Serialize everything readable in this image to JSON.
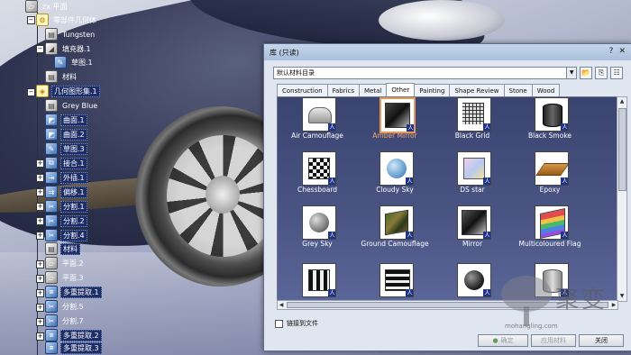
{
  "tree": {
    "items": [
      {
        "label": "zx 平面",
        "icon": "plane-icon"
      },
      {
        "label": "零部件几何体",
        "icon": "gear-icon"
      },
      {
        "label": "Tungsten",
        "icon": "material-icon"
      },
      {
        "label": "填充器.1",
        "icon": "fill-icon"
      },
      {
        "label": "草图.1",
        "icon": "sketch-icon"
      },
      {
        "label": "材料",
        "icon": "material-icon"
      },
      {
        "label": "几何图形集.1",
        "icon": "geometrical-set-icon"
      },
      {
        "label": "Grey Blue",
        "icon": "material-icon"
      },
      {
        "label": "曲面.1",
        "icon": "surface-icon"
      },
      {
        "label": "曲面.2",
        "icon": "surface-icon"
      },
      {
        "label": "草图.3",
        "icon": "sketch-icon"
      },
      {
        "label": "接合.1",
        "icon": "join-icon"
      },
      {
        "label": "外插.1",
        "icon": "extrapolate-icon"
      },
      {
        "label": "偏移.1",
        "icon": "offset-icon"
      },
      {
        "label": "分割.1",
        "icon": "split-icon"
      },
      {
        "label": "分割.2",
        "icon": "split-icon"
      },
      {
        "label": "分割.4",
        "icon": "split-icon"
      },
      {
        "label": "材料",
        "icon": "material-icon"
      },
      {
        "label": "平面.2",
        "icon": "plane-icon"
      },
      {
        "label": "平面.3",
        "icon": "plane-icon"
      },
      {
        "label": "多重提取.1",
        "icon": "multi-extract-icon"
      },
      {
        "label": "分割.5",
        "icon": "split-icon"
      },
      {
        "label": "分割.7",
        "icon": "split-icon"
      },
      {
        "label": "多重提取.2",
        "icon": "multi-extract-icon"
      },
      {
        "label": "多重提取.3",
        "icon": "multi-extract-icon"
      }
    ]
  },
  "dialog": {
    "title": "库 (只读)",
    "title_buttons": {
      "help": "?",
      "close": "✕"
    },
    "catalog_select": "默认材料目录",
    "tabs": [
      "Construction",
      "Fabrics",
      "Metal",
      "Other",
      "Painting",
      "Shape Review",
      "Stone",
      "Wood"
    ],
    "active_tab": "Other",
    "materials": [
      {
        "name": "Air Camouflage"
      },
      {
        "name": "Amber Mirror",
        "selected": true
      },
      {
        "name": "Black Grid"
      },
      {
        "name": "Black Smoke"
      },
      {
        "name": "Chessboard"
      },
      {
        "name": "Cloudy Sky"
      },
      {
        "name": "DS star"
      },
      {
        "name": "Epoxy"
      },
      {
        "name": "Grey Sky"
      },
      {
        "name": "Ground Camouflage"
      },
      {
        "name": "Mirror"
      },
      {
        "name": "Multicoloured Flag"
      },
      {
        "name": ""
      },
      {
        "name": ""
      },
      {
        "name": ""
      },
      {
        "name": ""
      }
    ],
    "link_checkbox_label": "链接到文件",
    "buttons": {
      "ok": "确定",
      "apply": "应用材料",
      "close": "关闭"
    }
  },
  "watermark": {
    "text": "聚变",
    "url": "mohangling.com"
  },
  "colors": {
    "selected": "#f4a76a",
    "tree_highlight": "#1d2d66"
  }
}
